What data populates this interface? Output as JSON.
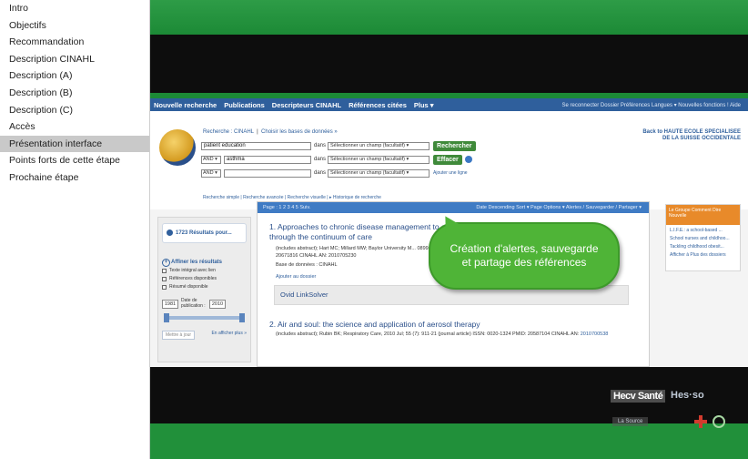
{
  "outline": {
    "items": [
      {
        "label": "Intro"
      },
      {
        "label": "Objectifs"
      },
      {
        "label": "Recommandation"
      },
      {
        "label": "Description CINAHL"
      },
      {
        "label": "Description (A)"
      },
      {
        "label": "Description (B)"
      },
      {
        "label": "Description (C)"
      },
      {
        "label": "Accès"
      },
      {
        "label": "Présentation interface"
      },
      {
        "label": "Points forts de cette étape"
      },
      {
        "label": "Prochaine étape"
      }
    ],
    "active_index": 8
  },
  "screenshot": {
    "navbar": {
      "items": [
        "Nouvelle recherche",
        "Publications",
        "Descripteurs CINAHL",
        "Références citées",
        "Plus ▾"
      ],
      "right": "Se reconnecter   Dossier   Préférences   Langues ▾   Nouvelles fonctions !   Aide"
    },
    "search": {
      "top_db": "Recherche : CINAHL",
      "top_choose": "Choisir les bases de données »",
      "row1_term": "patient education",
      "row2_op": "AND ▾",
      "row2_term": "asthma",
      "row3_op": "AND ▾",
      "row3_term": "",
      "in_label": "dans",
      "select_placeholder": "Sélectionner un champ (facultatif) ▾",
      "search_button": "Rechercher",
      "clear_button": "Effacer",
      "add_line": "Ajouter une ligne",
      "links": "Recherche simple  |  Recherche avancée  |  Recherche visuelle  |  ▸ Historique de recherche",
      "back_link": "Back to HAUTE ECOLE SPECIALISEE DE LA SUISSE OCCIDENTALE"
    },
    "left_panel": {
      "results_count": "1723 Résultats pour...",
      "refine": "Affiner les résultats",
      "checks": [
        "Texte intégral avec lien",
        "Références disponibles",
        "Résumé disponible"
      ],
      "year_from": "1981",
      "pub_label": "Date de publication :",
      "year_to": "2010",
      "update": "Mettre à jour",
      "show_more": "En afficher plus »"
    },
    "results": {
      "bar_left": "Page : 1  2  3  4  5  Suiv.",
      "bar_right": "Date Descending Sort ▾    Page Options ▾    Alertes / Sauvegarder / Partager ▾",
      "r1_title": "1.  Approaches to chronic disease management to strategies through the continuum of care",
      "r1_meta": "(includes abstract); Hart MC; Millard MW; Baylor University M... 0899-8280 PMID: 20671816 CINAHL AN: 2010705230",
      "r1_db": "Base de données : CINAHL",
      "r1_add": "Ajouter au dossier",
      "ovid": "Ovid LinkSolver",
      "r2_title": "2.  Air and soul: the science and application of aerosol therapy",
      "r2_meta": "(includes abstract); Rubin BK; Respiratory Care, 2010 Jul; 55 (7): 911-21 (journal article) ISSN: 0020-1324 PMID: 20587104 CINAHL AN:",
      "r2_an": "2010700538"
    },
    "right_panel": {
      "head": "Le Groupe Comment Dire Nouvelle",
      "items": [
        "L.I.F.E.: a school-based ...",
        "School nurses and childhoo...",
        "Tackling childhood obesit...",
        "Afficher à Plus des dossiers"
      ]
    }
  },
  "callout": {
    "text": "Création d'alertes, sauvegarde et partage des références"
  },
  "logos": {
    "hecv": "Hecv Santé",
    "hes": "Hes·so",
    "lasource": "La Source"
  },
  "colors": {
    "stage_green": "#1c8a36",
    "callout_green": "#4fb437",
    "navbar_blue": "#2f5f9c",
    "active_outline": "#c9c9c9"
  }
}
